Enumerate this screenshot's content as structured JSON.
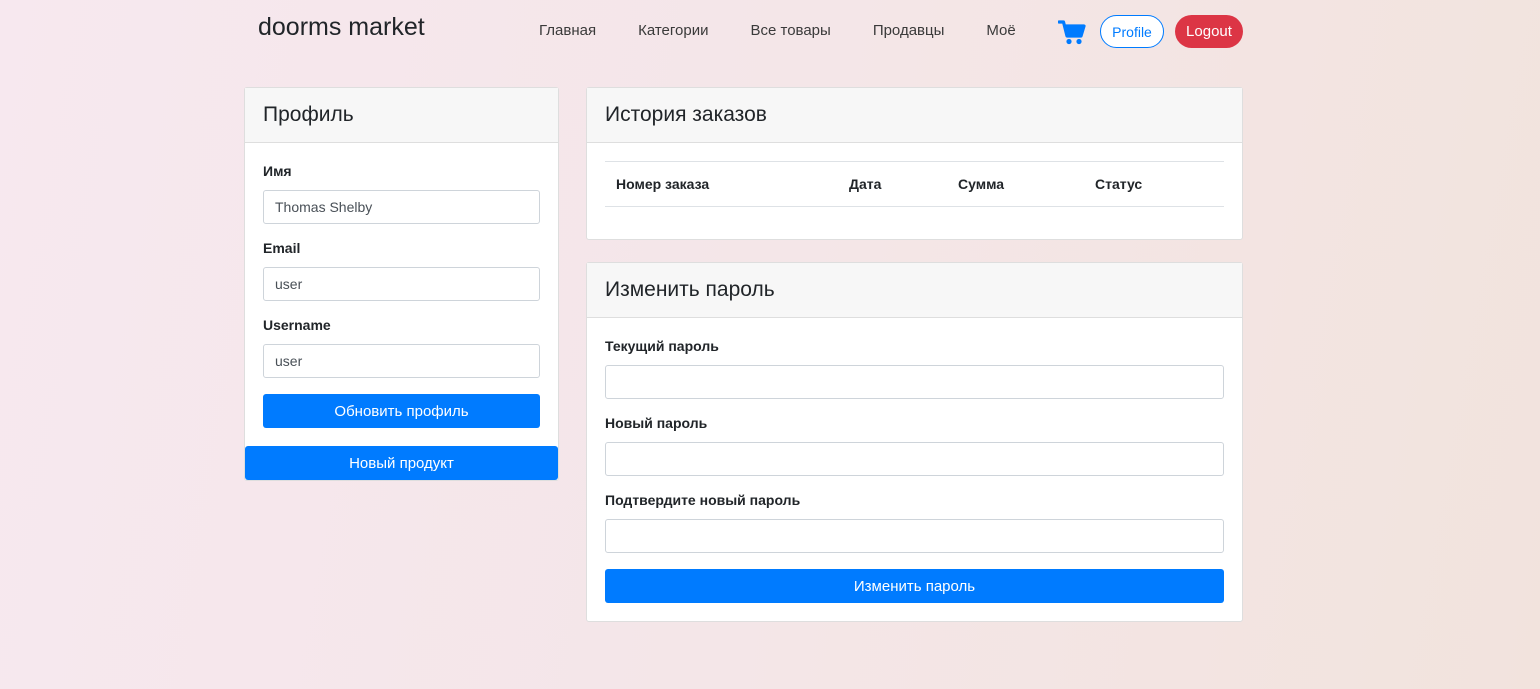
{
  "navbar": {
    "brand": "doorms market",
    "links": [
      "Главная",
      "Категории",
      "Все товары",
      "Продавцы",
      "Моё"
    ],
    "cart_icon": "shopping-cart-icon",
    "profile_label": "Profile",
    "logout_label": "Logout"
  },
  "profile": {
    "title": "Профиль",
    "name_label": "Имя",
    "name_value": "Thomas Shelby",
    "email_label": "Email",
    "email_value": "user",
    "username_label": "Username",
    "username_value": "user",
    "update_button": "Обновить профиль",
    "new_product_button": "Новый продукт"
  },
  "orders": {
    "title": "История заказов",
    "columns": [
      "Номер заказа",
      "Дата",
      "Сумма",
      "Статус"
    ]
  },
  "password": {
    "title": "Изменить пароль",
    "current_label": "Текущий пароль",
    "new_label": "Новый пароль",
    "confirm_label": "Подтвердите новый пароль",
    "submit_button": "Изменить пароль"
  },
  "colors": {
    "primary": "#007bff",
    "danger": "#dc3545"
  }
}
